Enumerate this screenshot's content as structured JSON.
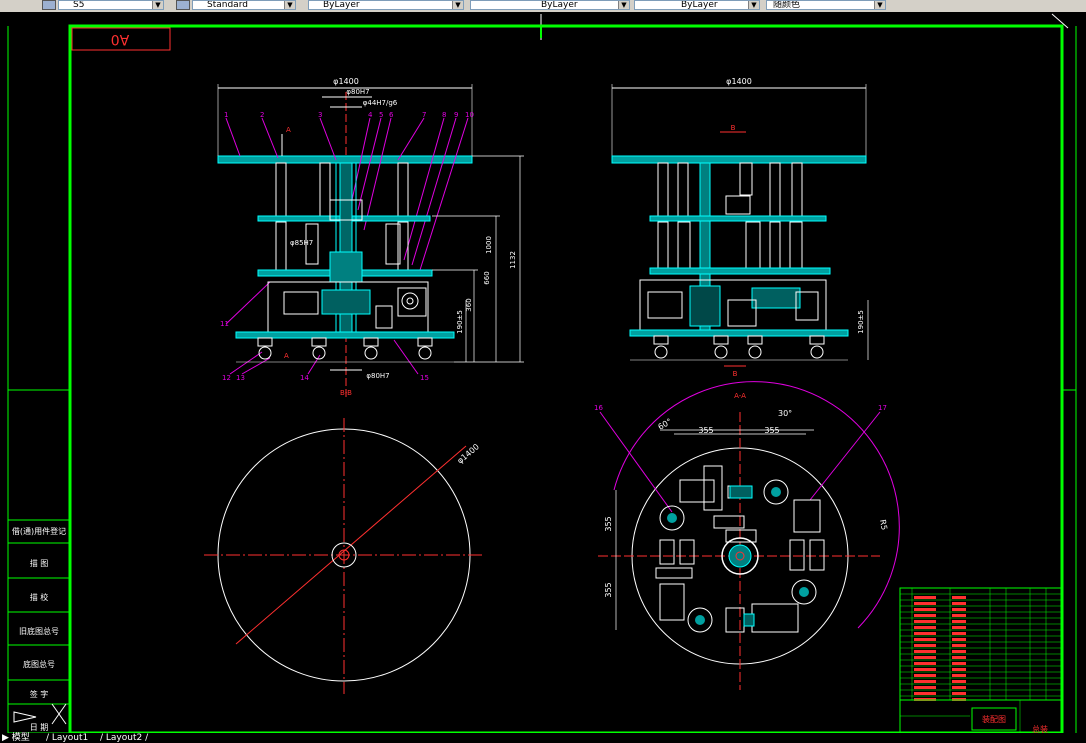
{
  "toolbar": {
    "textstyle_value": "Standard",
    "layer_value": "ByLayer",
    "linetype_value": "ByLayer",
    "lineweight_value": "ByLayer",
    "color_value": "随颜色",
    "dimstyle_value": "S5"
  },
  "drawing": {
    "sheet_code": "A0",
    "front_view": {
      "top_dim": "φ1400",
      "bore_dim1": "φ80H7",
      "bore_dim2": "φ44H7/g6",
      "bore_dim3": "φ85H7",
      "bottom_dim": "φ80H7",
      "height_total": "1132",
      "height_1000": "1000",
      "height_660": "660",
      "height_360": "360",
      "height_190": "190±5",
      "section_label": "B-B",
      "cut_a": "A",
      "callouts": [
        "1",
        "2",
        "3",
        "4",
        "5",
        "6",
        "7",
        "8",
        "9",
        "10",
        "11",
        "12",
        "13",
        "14",
        "15"
      ]
    },
    "side_view": {
      "top_dim": "φ1400",
      "height_190": "190±5",
      "cut_b": "B"
    },
    "top_view": {
      "dia": "φ1400"
    },
    "section_view": {
      "label": "A-A",
      "dim_355a": "355",
      "dim_355b": "355",
      "dim_355c": "355",
      "dim_355d": "355",
      "angle_30": "30°",
      "angle_60": "60°",
      "dim_r": "R5",
      "callout_16": "16",
      "callout_17": "17"
    },
    "left_panel": {
      "row1": "借(通)用件登记",
      "row2": "旧底图总号",
      "row3": "描 图",
      "row4": "描 校",
      "row5": "底图总号",
      "row6": "签 字",
      "row7": "日 期"
    },
    "title_block": {
      "name": "装配图",
      "drawing_no": "总装"
    }
  },
  "tabs": {
    "model": "模型",
    "layout1": "Layout1",
    "layout2": "Layout2"
  }
}
